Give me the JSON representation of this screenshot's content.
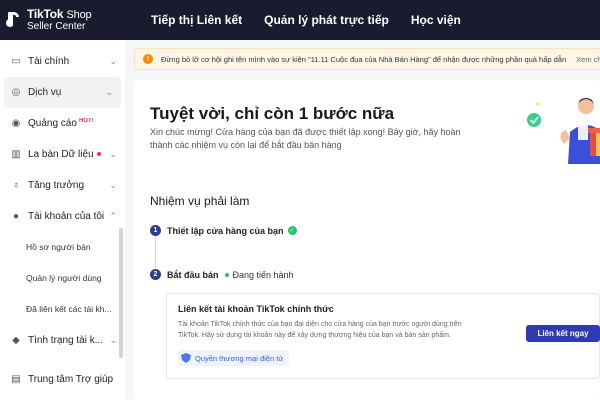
{
  "brand": {
    "name": "TikTok",
    "name_suffix": "Shop",
    "subtitle": "Seller Center"
  },
  "topnav": [
    {
      "label": "Tiếp thị Liên kết"
    },
    {
      "label": "Quản lý phát trực tiếp"
    },
    {
      "label": "Học viện"
    }
  ],
  "sidebar": {
    "items": [
      {
        "label": "Tài chính",
        "icon": "wallet-icon"
      },
      {
        "label": "Dịch vụ",
        "icon": "globe-icon"
      },
      {
        "label": "Quảng cáo",
        "icon": "ads-icon",
        "badge": "HOT!"
      },
      {
        "label": "La bàn Dữ liệu",
        "icon": "compass-icon"
      },
      {
        "label": "Tăng trưởng",
        "icon": "growth-icon"
      },
      {
        "label": "Tài khoản của tôi",
        "icon": "user-icon"
      },
      {
        "label": "Tình trạng tài k...",
        "icon": "status-icon"
      },
      {
        "label": "Trung tâm Trợ giúp",
        "icon": "help-icon"
      }
    ],
    "subitems": [
      {
        "label": "Hồ sơ người bán"
      },
      {
        "label": "Quản lý người dùng"
      },
      {
        "label": "Đã liên kết các tài kh..."
      }
    ]
  },
  "banner": {
    "text": "Đừng bỏ lỡ cơ hội ghi tên mình vào sự kiện \"11.11 Cuộc đua của Nhà Bán Hàng\" để nhận được những phần quà hấp dẫn",
    "link": "Xem chi"
  },
  "main": {
    "title": "Tuyệt vời, chỉ còn 1 bước nữa",
    "description": "Xin chúc mừng! Cửa hàng của bạn đã được thiết lập xong! Bây giờ, hãy hoàn thành các nhiệm vụ còn lại để bắt đầu bán hàng",
    "section_title": "Nhiệm vụ phải làm",
    "steps": [
      {
        "num": "1",
        "label": "Thiết lập cửa hàng của bạn",
        "done": true
      },
      {
        "num": "2",
        "label": "Bắt đầu bán",
        "status": "Đang tiến hành"
      }
    ],
    "task": {
      "title": "Liên kết tài khoản TikTok chính thức",
      "description": "Tài khoản TikTok chính thức của bạn đại diện cho cửa hàng của bạn trước người dùng trên TikTok. Hãy sử dụng tài khoản này để xây dựng thương hiệu của bạn và bán sản phẩm.",
      "tag": "Quyền thương mại điện tử",
      "button": "Liên kết ngay"
    }
  },
  "colors": {
    "topbar": "#1a1b2e",
    "primary_button": "#2e3ab5",
    "success": "#25c06b",
    "warning": "#ff8a00",
    "hot": "#fe2c55"
  }
}
